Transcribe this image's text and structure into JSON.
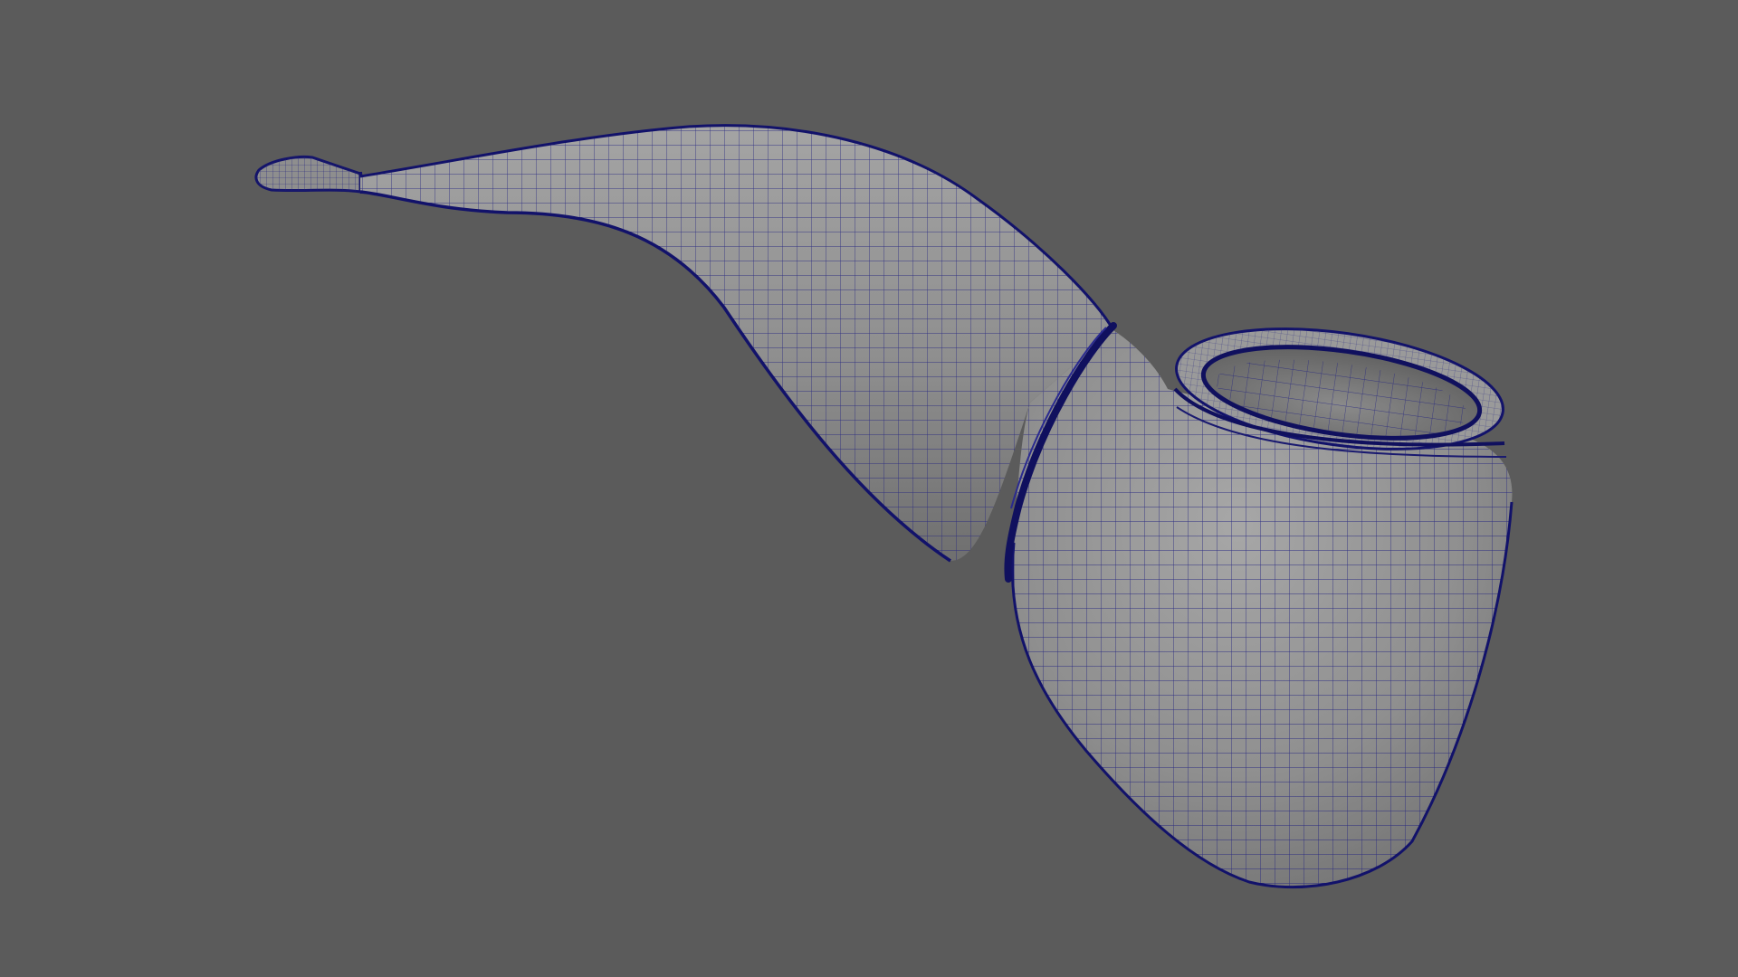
{
  "viewport": {
    "background_color": "#5b5b5b"
  },
  "model": {
    "object": "tobacco-pipe",
    "display_mode": "shaded-wireframe",
    "surface_color": "#8f8f8f",
    "wire_color": "#1f1f7a",
    "edge_color": "#101060"
  }
}
